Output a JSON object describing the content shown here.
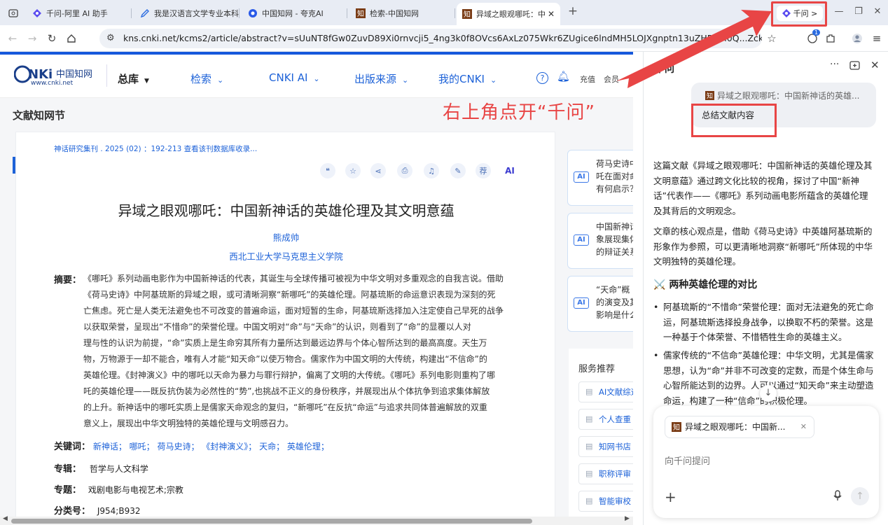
{
  "browser": {
    "tabs": [
      {
        "title": "",
        "icon": "tab-overview-icon"
      },
      {
        "title": "千问-阿里 AI 助手",
        "icon": "qianwen-icon"
      },
      {
        "title": "我是汉语言文学专业本科",
        "icon": "pen-icon"
      },
      {
        "title": "中国知网 - 夸克AI",
        "icon": "quark-icon"
      },
      {
        "title": "检索-中国知网",
        "icon": "cnki-icon"
      },
      {
        "title": "异域之眼观哪吒：中",
        "icon": "cnki-icon",
        "active": true
      }
    ],
    "new_tab": "+",
    "qianwen_button": "千问 >",
    "window_controls": {
      "minimize": "—",
      "restore": "❐",
      "close": "✕"
    },
    "url": "kns.cnki.net/kcms2/article/abstract?v=sUuNT8fGw0ZuvD89Xi0rnvcji5_4ng3k0f8OVcs6AxLz075Wkr6ZUgice6lndMH5LOJXgnptn13uZHRp9i0Q...ZckiFG...",
    "notification_count": "1"
  },
  "cnki": {
    "logo_text": "CNKi中国知网",
    "logo_url": "www.cnki.net",
    "nav": {
      "library": "总库",
      "search": "检索",
      "ai": "CNKI AI",
      "publish": "出版来源",
      "my": "我的CNKI",
      "recharge": "充值",
      "member": "会员"
    },
    "section_title": "文献知网节",
    "article": {
      "source": "神话研究集刊 . 2025 (02) ：192-213 查看该刊数据库收录...",
      "title": "异域之眼观哪吒：中国新神话的英雄伦理及其文明意蕴",
      "author": "熊成帅",
      "affiliation": "西北工业大学马克思主义学院",
      "abstract_label": "摘要：",
      "abstract_lines": [
        "《哪吒》系列动画电影作为中国新神话的代表，其诞生与全球传播可被视为中华文明对多重观念的自我言说。借助",
        "《荷马史诗》中阿基琉斯的异域之眼，或可清晰洞察“新哪吒”的英雄伦理。阿基琉斯的命运意识表现为深刻的死",
        "亡焦虑。死亡是人类无法避免也不可改变的普遍命运，面对短暂的生命，阿基琉斯选择加入注定使自己早死的战争",
        "以获取荣誉，呈现出“不惜命”的荣誉伦理。中国文明对“命”与“天命”的认识，则看到了“命”的显覆以人对",
        "理与性的认识为前提，“命”实质上是生命穷其所有力量所达到最远边界与个体心智所达到的最高高度。天生万",
        "物，万物源于一却不能合，唯有人才能“知天命”以使万物合。儒家作为中国文明的大传统，构建出“不信命”的",
        "英雄伦理。《封神演义》中的哪吒以天命为暴力与罪行辩护，偏离了文明的大传统。《哪吒》系列电影则重构了哪",
        "吒的英雄伦理——既反抗伪装为必然性的“势”,也挑战不正义的身份秩序，并展现出从个体抗争到追求集体解放",
        "的上升。新神话中的哪吒实质上是儒家天命观念的复归，“新哪吒”在反抗“命运”与追求共同体普遍解放的双重",
        "意义上，展现出中华文明独特的英雄伦理与文明感召力。"
      ],
      "keywords_label": "关键词：",
      "keywords": "新神话；  哪吒；  荷马史诗；  《封神演义》；  天命；  英雄伦理；",
      "series_label": "专辑：",
      "series": "哲学与人文科学",
      "topic_label": "专题：",
      "topic": "戏剧电影与电视艺术;宗教",
      "class_label": "分类号：",
      "class": "J954;B932"
    },
    "ai_cards": [
      {
        "badge": "AI",
        "text": "荷马史诗中\n吒在面对命\n有何启示？"
      },
      {
        "badge": "AI",
        "text": "中国新神话\n象展现集体\n的辩证关系"
      },
      {
        "badge": "AI",
        "text": "“天命”概\n的演变及其\n影响是什么"
      }
    ],
    "service_title": "服务推荐",
    "services": [
      "AI文献综述",
      "个人查重",
      "知网书店",
      "职称评审",
      "智能审校"
    ]
  },
  "panel": {
    "title": "千问",
    "quote": "异域之眼观哪吒：中国新神话的英雄...",
    "user_message": "总结文献内容",
    "answer_p1": "这篇文献《异域之眼观哪吒：中国新神话的英雄伦理及其文明意蕴》通过跨文化比较的视角，探讨了中国“新神话”代表作——《哪吒》系列动画电影所蕴含的英雄伦理及其背后的文明观念。",
    "answer_p2": "文章的核心观点是，借助《荷马史诗》中英雄阿基琉斯的形象作为参照，可以更清晰地洞察“新哪吒”所体现的中华文明独特的英雄伦理。",
    "heading_icon": "⚔️",
    "heading": "两种英雄伦理的对比",
    "bullet1": "阿基琉斯的“不惜命”荣誉伦理：面对无法避免的死亡命运，阿基琉斯选择投身战争，以换取不朽的荣誉。这是一种基于个体荣誉、不惜牺牲生命的英雄主义。",
    "bullet2": "儒家传统的“不信命”英雄伦理：中华文明，尤其是儒家思想，认为“命”并非不可改变的定数，而是个体生命与心智所能达到的边界。人可以通过“知天命”来主动塑造命运，构建了一种“信命”的积极伦理。",
    "attachment": "异域之眼观哪吒：中国新...",
    "input_placeholder": "向千问提问"
  },
  "annotation": {
    "text": "右上角点开“千问”",
    "color": "#e84545"
  }
}
